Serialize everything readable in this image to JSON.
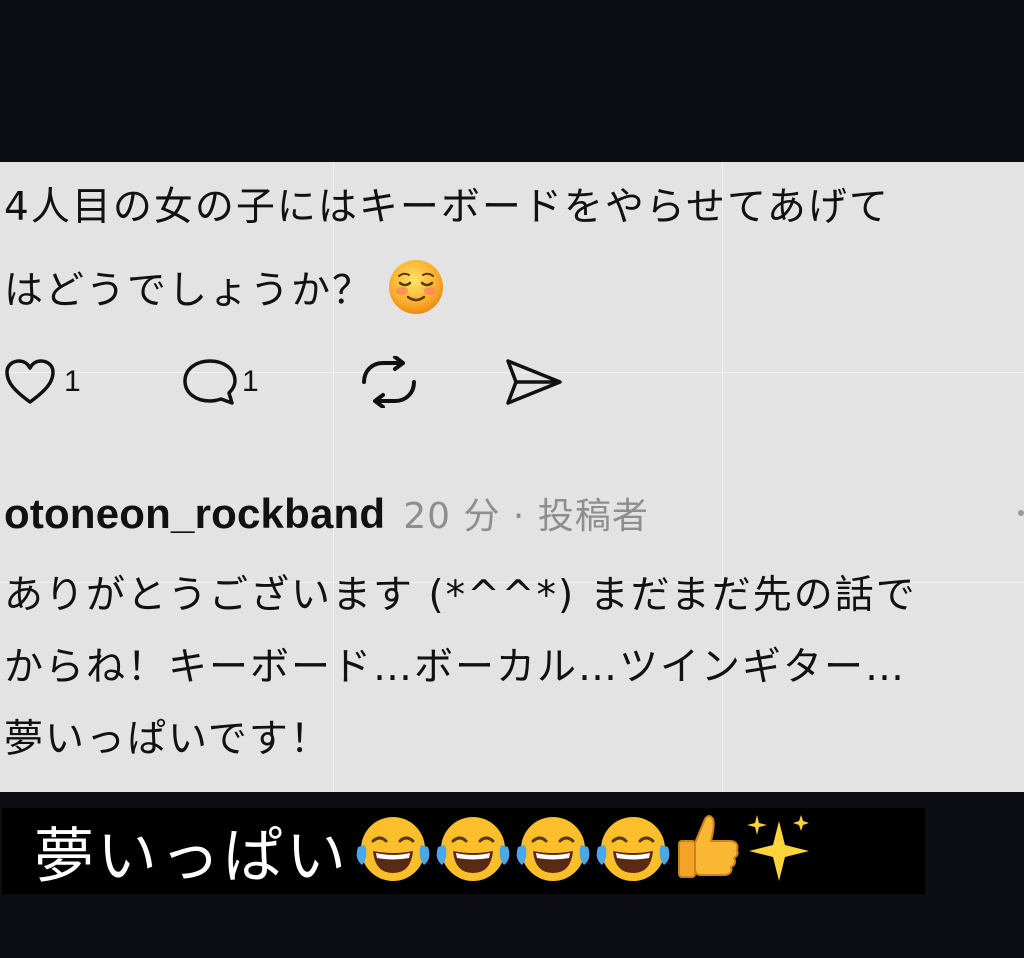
{
  "post": {
    "text_line_1": "4人目の女の子にはキーボードをやらせてあげて",
    "text_line_2": "はどうでしょうか？",
    "text_emoji": "relieved-blushing-emoji"
  },
  "actions": {
    "like_icon": "heart-icon",
    "like_count": "1",
    "comment_icon": "comment-icon",
    "comment_count": "1",
    "repost_icon": "repost-icon",
    "share_icon": "send-icon"
  },
  "reply": {
    "username": "otoneon_rockband",
    "meta": "20 分 · 投稿者",
    "line_1": "ありがとうございます (*^^*) まだまだ先の話で",
    "line_2": "からね！キーボード…ボーカル…ツインギター…",
    "line_3": "夢いっぱいです！"
  },
  "caption": {
    "text": "夢いっぱい",
    "emojis": [
      "laughing-tears-emoji",
      "laughing-tears-emoji",
      "laughing-tears-emoji",
      "laughing-tears-emoji",
      "thumbs-up-emoji",
      "sparkles-emoji"
    ]
  },
  "colors": {
    "background": "#0b0d12",
    "card": "#e3e3e3",
    "text": "#111111",
    "meta": "#8e8e8e",
    "caption_bg": "#000000",
    "caption_text": "#ffffff"
  }
}
